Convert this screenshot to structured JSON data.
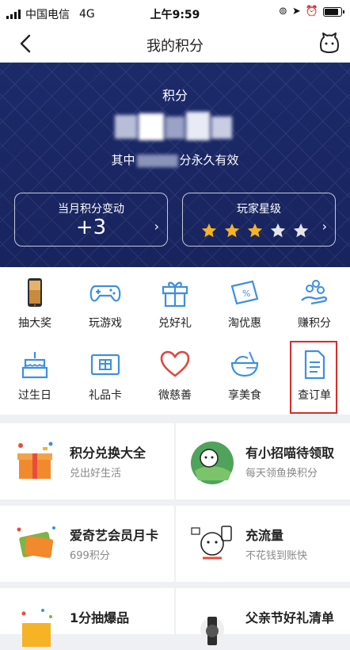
{
  "status_bar": {
    "carrier": "中国电信",
    "network": "4G",
    "time": "上午9:59"
  },
  "nav": {
    "title": "我的积分"
  },
  "header": {
    "points_label": "积分",
    "permanent_prefix": "其中",
    "permanent_suffix": "分永久有效",
    "monthly_change_title": "当月积分变动",
    "monthly_change_value": "+3",
    "player_rating_title": "玩家星级",
    "player_rating_stars": 3,
    "player_rating_max": 5
  },
  "grid": {
    "items": [
      {
        "label": "抽大奖",
        "icon": "phone-prize-icon"
      },
      {
        "label": "玩游戏",
        "icon": "gamepad-icon"
      },
      {
        "label": "兑好礼",
        "icon": "gift-icon"
      },
      {
        "label": "淘优惠",
        "icon": "coupon-icon"
      },
      {
        "label": "赚积分",
        "icon": "coins-hand-icon"
      },
      {
        "label": "过生日",
        "icon": "cake-icon"
      },
      {
        "label": "礼品卡",
        "icon": "gift-card-icon"
      },
      {
        "label": "微慈善",
        "icon": "heart-icon"
      },
      {
        "label": "享美食",
        "icon": "bowl-icon"
      },
      {
        "label": "查订单",
        "icon": "document-icon"
      }
    ],
    "highlight_color": "#d92b2b"
  },
  "promos": [
    {
      "title": "积分兑换大全",
      "subtitle": "兑出好生活"
    },
    {
      "title": "有小招喵待领取",
      "subtitle": "每天领鱼换积分"
    },
    {
      "title": "爱奇艺会员月卡",
      "subtitle": "699积分"
    },
    {
      "title": "充流量",
      "subtitle": "不花钱到账快"
    },
    {
      "title": "1分抽爆品",
      "subtitle": ""
    },
    {
      "title": "父亲节好礼清单",
      "subtitle": ""
    }
  ],
  "colors": {
    "header_bg": "#1c2a6a",
    "accent_blue": "#3d8fe0",
    "star_gold": "#f5b325",
    "star_empty": "#e6e6ea"
  }
}
